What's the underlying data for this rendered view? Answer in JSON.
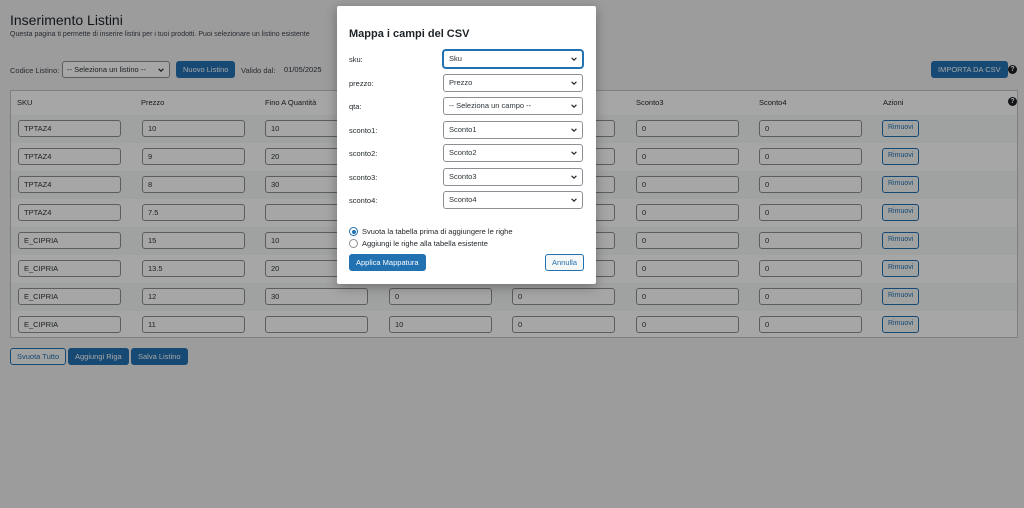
{
  "page": {
    "title": "Inserimento Listini",
    "description": "Questa pagina ti permette di inserire listini per i tuoi prodotti. Puoi selezionare un listino esistente"
  },
  "toolbar": {
    "codice_label": "Codice Listino:",
    "codice_select": "-- Seleziona un listino --",
    "nuovo_button": "Nuovo Listino",
    "valido_label": "Valido dal:",
    "valido_value": "01/05/2025",
    "importa_button": "IMPORTA DA CSV",
    "help": "?"
  },
  "table": {
    "headers": [
      "SKU",
      "Prezzo",
      "Fino A Quantità",
      "",
      "",
      "Sconto3",
      "Sconto4",
      "Azioni"
    ],
    "help": "?",
    "remove_label": "Rimuovi",
    "rows": [
      {
        "sku": "TPTAZ4",
        "prezzo": "10",
        "qta": "10",
        "s1": "",
        "s2": "",
        "s3": "0",
        "s4": "0"
      },
      {
        "sku": "TPTAZ4",
        "prezzo": "9",
        "qta": "20",
        "s1": "",
        "s2": "",
        "s3": "0",
        "s4": "0"
      },
      {
        "sku": "TPTAZ4",
        "prezzo": "8",
        "qta": "30",
        "s1": "",
        "s2": "",
        "s3": "0",
        "s4": "0"
      },
      {
        "sku": "TPTAZ4",
        "prezzo": "7.5",
        "qta": "",
        "s1": "",
        "s2": "",
        "s3": "0",
        "s4": "0"
      },
      {
        "sku": "E_CIPRIA",
        "prezzo": "15",
        "qta": "10",
        "s1": "",
        "s2": "",
        "s3": "0",
        "s4": "0"
      },
      {
        "sku": "E_CIPRIA",
        "prezzo": "13.5",
        "qta": "20",
        "s1": "",
        "s2": "",
        "s3": "0",
        "s4": "0"
      },
      {
        "sku": "E_CIPRIA",
        "prezzo": "12",
        "qta": "30",
        "s1": "0",
        "s2": "0",
        "s3": "0",
        "s4": "0"
      },
      {
        "sku": "E_CIPRIA",
        "prezzo": "11",
        "qta": "",
        "s1": "10",
        "s2": "0",
        "s3": "0",
        "s4": "0"
      }
    ]
  },
  "footer": {
    "svuota_button": "Svuota Tutto",
    "aggiungi_button": "Aggiungi Riga",
    "salva_button": "Salva Listino"
  },
  "modal": {
    "title": "Mappa i campi del CSV",
    "fields": [
      {
        "label": "sku:",
        "value": "Sku"
      },
      {
        "label": "prezzo:",
        "value": "Prezzo"
      },
      {
        "label": "qta:",
        "value": "-- Seleziona un campo --"
      },
      {
        "label": "sconto1:",
        "value": "Sconto1"
      },
      {
        "label": "sconto2:",
        "value": "Sconto2"
      },
      {
        "label": "sconto3:",
        "value": "Sconto3"
      },
      {
        "label": "sconto4:",
        "value": "Sconto4"
      }
    ],
    "radio_replace": "Svuota la tabella prima di aggiungere le righe",
    "radio_append": "Aggiungi le righe alla tabella esistente",
    "apply_button": "Applica Mappatura",
    "cancel_button": "Annulla"
  },
  "colors": {
    "accent": "#2271b1",
    "background": "#f0f0f1"
  }
}
